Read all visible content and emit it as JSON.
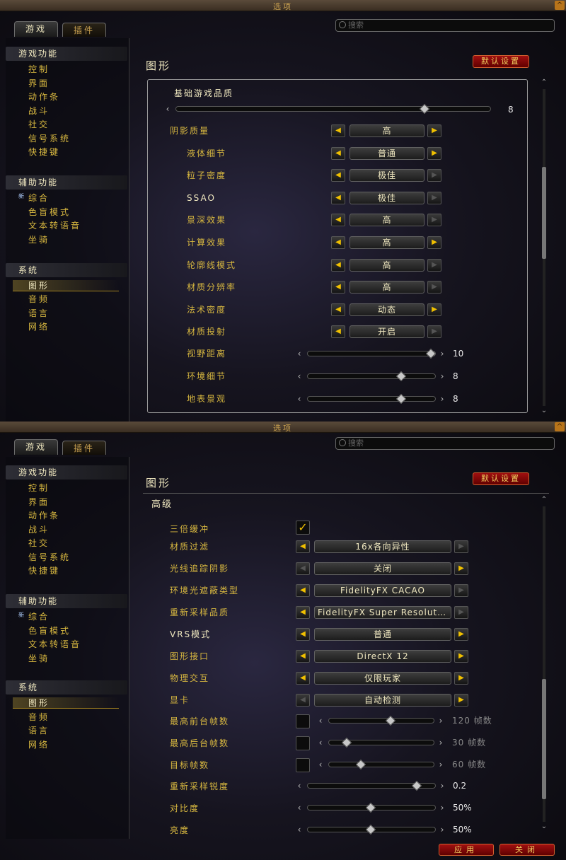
{
  "window_title": "选项",
  "close_glyph": "^",
  "tabs": [
    {
      "label": "游戏"
    },
    {
      "label": "插件"
    }
  ],
  "search_placeholder": "搜索",
  "sidebar": {
    "sections": [
      {
        "title": "游戏功能",
        "items": [
          "控制",
          "界面",
          "动作条",
          "战斗",
          "社交",
          "信号系统",
          "快捷键"
        ]
      },
      {
        "title": "辅助功能",
        "new_tag": "新",
        "items": [
          "综合",
          "色盲模式",
          "文本转语音",
          "坐骑"
        ]
      },
      {
        "title": "系统",
        "items": [
          "图形",
          "音频",
          "语言",
          "网络"
        ],
        "selected": "图形"
      }
    ]
  },
  "page_title": "图形",
  "default_button": "默认设置",
  "panel1": {
    "base_quality_label": "基础游戏品质",
    "base_quality_value": "8",
    "base_quality_fraction": 0.8,
    "rows": [
      {
        "label": "阴影质量",
        "value": "高",
        "left_enabled": true,
        "right_enabled": true
      },
      {
        "label": "液体细节",
        "value": "普通",
        "left_enabled": true,
        "right_enabled": true
      },
      {
        "label": "粒子密度",
        "value": "极佳",
        "left_enabled": true,
        "right_enabled": false
      },
      {
        "label": "SSAO",
        "value": "极佳",
        "left_enabled": true,
        "right_enabled": false
      },
      {
        "label": "景深效果",
        "value": "高",
        "left_enabled": true,
        "right_enabled": false
      },
      {
        "label": "计算效果",
        "value": "高",
        "left_enabled": true,
        "right_enabled": true
      },
      {
        "label": "轮廓线模式",
        "value": "高",
        "left_enabled": true,
        "right_enabled": false
      },
      {
        "label": "材质分辨率",
        "value": "高",
        "left_enabled": true,
        "right_enabled": false
      },
      {
        "label": "法术密度",
        "value": "动态",
        "left_enabled": true,
        "right_enabled": true
      },
      {
        "label": "材质投射",
        "value": "开启",
        "left_enabled": true,
        "right_enabled": false
      }
    ],
    "sliders": [
      {
        "label": "视野距离",
        "value": "10",
        "fraction": 1.0
      },
      {
        "label": "环境细节",
        "value": "8",
        "fraction": 0.75
      },
      {
        "label": "地表景观",
        "value": "8",
        "fraction": 0.75
      }
    ]
  },
  "panel2": {
    "section_title": "高级",
    "triple_buffer_label": "三倍缓冲",
    "triple_buffer_checked": true,
    "check_glyph": "✓",
    "rows": [
      {
        "label": "材质过滤",
        "value": "16x各向异性",
        "left_enabled": true,
        "right_enabled": false
      },
      {
        "label": "光线追踪阴影",
        "value": "关闭",
        "left_enabled": false,
        "right_enabled": true
      },
      {
        "label": "环境光遮蔽类型",
        "value": "FidelityFX CACAO",
        "left_enabled": true,
        "right_enabled": false
      },
      {
        "label": "重新采样品质",
        "value": "FidelityFX Super Resoluti…",
        "left_enabled": true,
        "right_enabled": false
      },
      {
        "label": "VRS模式",
        "value": "普通",
        "left_enabled": true,
        "right_enabled": true
      },
      {
        "label": "图形接口",
        "value": "DirectX 12",
        "left_enabled": true,
        "right_enabled": true
      },
      {
        "label": "物理交互",
        "value": "仅限玩家",
        "left_enabled": true,
        "right_enabled": true
      },
      {
        "label": "显卡",
        "value": "自动检测",
        "left_enabled": false,
        "right_enabled": true
      }
    ],
    "fps_sliders": [
      {
        "label": "最高前台帧数",
        "value": "120 帧数",
        "fraction": 0.6
      },
      {
        "label": "最高后台帧数",
        "value": "30 帧数",
        "fraction": 0.15
      },
      {
        "label": "目标帧数",
        "value": "60 帧数",
        "fraction": 0.3
      }
    ],
    "sliders": [
      {
        "label": "重新采样锐度",
        "value": "0.2",
        "fraction": 0.88
      },
      {
        "label": "对比度",
        "value": "50%",
        "fraction": 0.5
      },
      {
        "label": "亮度",
        "value": "50%",
        "fraction": 0.5
      }
    ]
  },
  "bottom_buttons": {
    "apply": "应用",
    "close": "关闭"
  },
  "glyphs": {
    "left": "◀",
    "right": "▶",
    "chev_left": "‹",
    "chev_right": "›",
    "up": "⌃",
    "down": "⌄"
  }
}
